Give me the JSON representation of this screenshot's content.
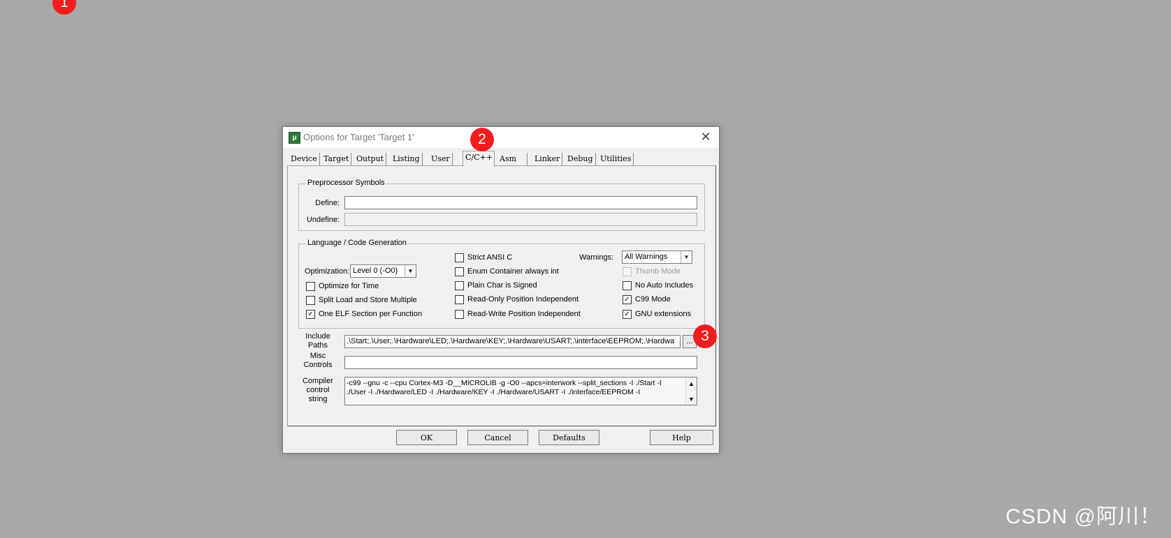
{
  "markers": [
    "1",
    "2",
    "3"
  ],
  "watermark": "CSDN @阿川！",
  "dialog": {
    "title": "Options for Target 'Target 1'",
    "close_glyph": "✕",
    "tabs": [
      "Device",
      "Target",
      "Output",
      "Listing",
      "User",
      "C/C++",
      "Asm",
      "Linker",
      "Debug",
      "Utilities"
    ],
    "active_tab": "C/C++",
    "preprocessor": {
      "legend": "Preprocessor Symbols",
      "define_label": "Define:",
      "define_value": "",
      "undefine_label": "Undefine:",
      "undefine_value": ""
    },
    "language": {
      "legend": "Language / Code Generation",
      "optimization_label": "Optimization:",
      "optimization_value": "Level 0 (-O0)",
      "warnings_label": "Warnings:",
      "warnings_value": "All Warnings",
      "checkboxes": {
        "optimize_time": {
          "label": "Optimize for Time",
          "checked": false
        },
        "split_load": {
          "label": "Split Load and Store Multiple",
          "checked": false
        },
        "one_elf": {
          "label": "One ELF Section per Function",
          "checked": true
        },
        "strict_ansi": {
          "label": "Strict ANSI C",
          "checked": false
        },
        "enum_container": {
          "label": "Enum Container always int",
          "checked": false
        },
        "plain_char": {
          "label": "Plain Char is Signed",
          "checked": false
        },
        "ro_pos": {
          "label": "Read-Only Position Independent",
          "checked": false
        },
        "rw_pos": {
          "label": "Read-Write Position Independent",
          "checked": false
        },
        "thumb_mode": {
          "label": "Thumb Mode",
          "checked": false,
          "disabled": true
        },
        "no_auto_includes": {
          "label": "No Auto Includes",
          "checked": false
        },
        "c99_mode": {
          "label": "C99 Mode",
          "checked": true
        },
        "gnu_ext": {
          "label": "GNU extensions",
          "checked": true
        }
      }
    },
    "include_paths": {
      "label_line1": "Include",
      "label_line2": "Paths",
      "value": ".\\Start;.\\User;.\\Hardware\\LED;.\\Hardware\\KEY;.\\Hardware\\USART;.\\interface\\EEPROM;.\\Hardwa",
      "browse_label": "..."
    },
    "misc_controls": {
      "label_line1": "Misc",
      "label_line2": "Controls",
      "value": ""
    },
    "compiler_string": {
      "label_line1": "Compiler",
      "label_line2": "control",
      "label_line3": "string",
      "line1": "-c99 --gnu -c --cpu Cortex-M3 -D__MICROLIB -g -O0 --apcs=interwork --split_sections -I ./Start -I",
      "line2": "./User -I ./Hardware/LED -I ./Hardware/KEY -I ./Hardware/USART -I ./interface/EEPROM -I"
    },
    "buttons": {
      "ok": "OK",
      "cancel": "Cancel",
      "defaults": "Defaults",
      "help": "Help"
    }
  }
}
